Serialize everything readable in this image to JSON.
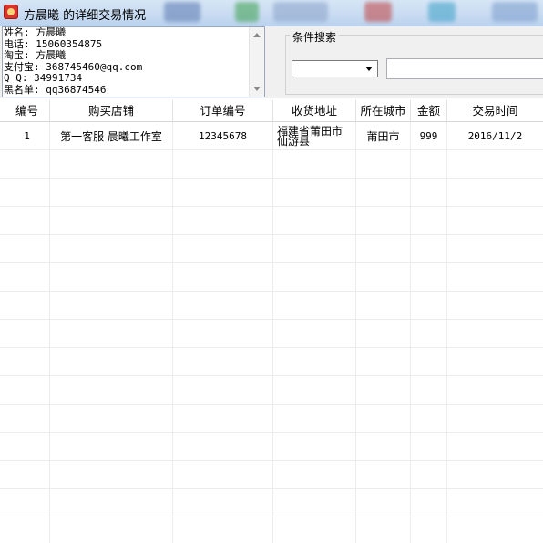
{
  "window": {
    "title": "方晨曦 的详细交易情况"
  },
  "info": {
    "lines": [
      "姓名: 方晨曦",
      "电话: 15060354875",
      "淘宝: 方晨曦",
      "支付宝: 368745460@qq.com",
      "Q Q: 34991734",
      "黑名单: qq36874546"
    ]
  },
  "search": {
    "group_label": "条件搜索",
    "combo_value": "",
    "input_value": ""
  },
  "table": {
    "columns": [
      "编号",
      "购买店铺",
      "订单编号",
      "收货地址",
      "所在城市",
      "金额",
      "交易时间"
    ],
    "rows": [
      {
        "id": "1",
        "shop": "第一客服 晨曦工作室",
        "order": "12345678",
        "address_1": "福建省莆田市",
        "address_2": "仙游县",
        "city": "莆田市",
        "amount": "999",
        "time": "2016/11/2"
      }
    ]
  },
  "colors": {
    "title_bar": "#c9dcf2",
    "panel": "#f0f0f0",
    "grid_line": "#ececec"
  }
}
